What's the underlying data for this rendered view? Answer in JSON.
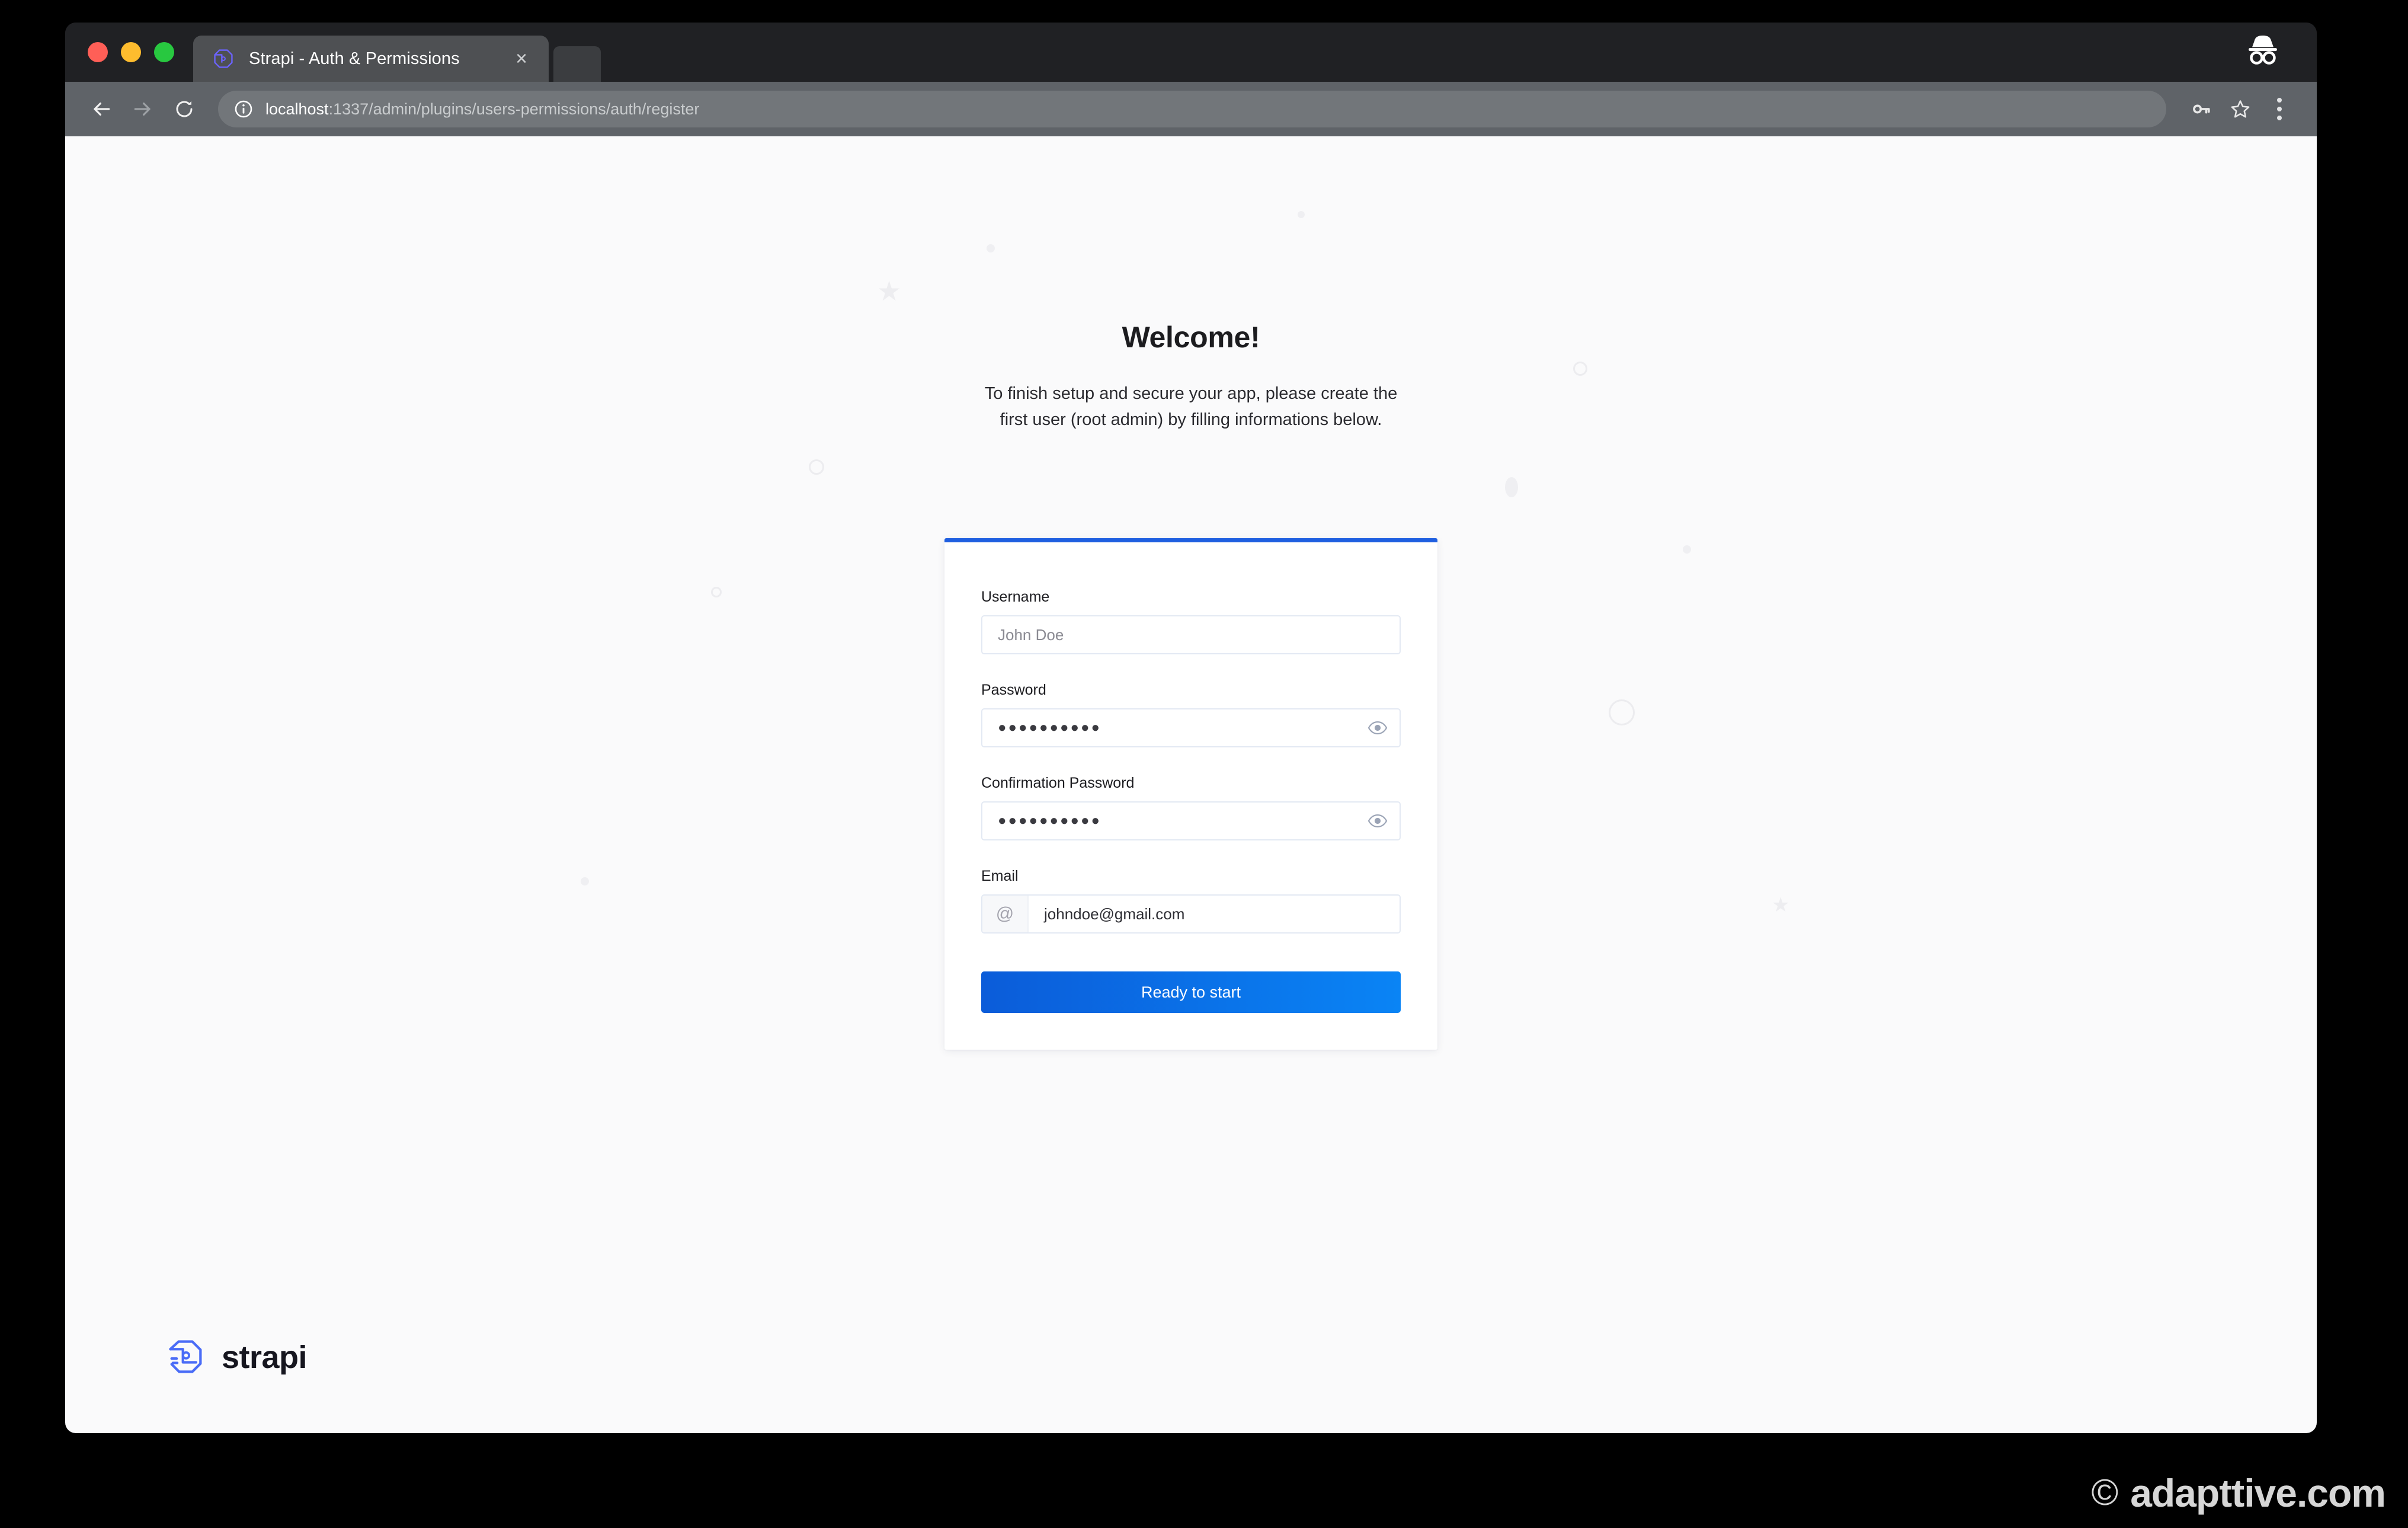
{
  "browser": {
    "tab": {
      "title": "Strapi - Auth & Permissions",
      "favicon_name": "strapi-favicon",
      "close_label": "×"
    },
    "incognito_label": "incognito-icon",
    "nav": {
      "back_label": "Back",
      "forward_label": "Forward",
      "reload_label": "Reload"
    },
    "omnibox": {
      "info_label": "Site information",
      "host": "localhost",
      "path": ":1337/admin/plugins/users-permissions/auth/register",
      "full_url": "localhost:1337/admin/plugins/users-permissions/auth/register"
    },
    "actions": {
      "password_manager_label": "Passwords",
      "bookmark_label": "Bookmark this tab",
      "menu_label": "Customize and control Google Chrome"
    }
  },
  "page": {
    "heading": "Welcome!",
    "subtitle": "To finish setup and secure your app, please create the first user (root admin) by filling informations below.",
    "form": {
      "fields": [
        {
          "label": "Username",
          "value": "",
          "placeholder": "John Doe",
          "is_placeholder": true,
          "type": "text"
        },
        {
          "label": "Password",
          "value": "●●●●●●●●●●",
          "placeholder": "",
          "is_placeholder": false,
          "type": "password"
        },
        {
          "label": "Confirmation Password",
          "value": "●●●●●●●●●●",
          "placeholder": "",
          "is_placeholder": false,
          "type": "password"
        },
        {
          "label": "Email",
          "value": "johndoe@gmail.com",
          "placeholder": "johndoe@gmail.com",
          "is_placeholder": false,
          "type": "email",
          "addon": "@"
        }
      ],
      "submit_label": "Ready to start"
    },
    "logo": {
      "wordmark": "strapi",
      "mark_name": "strapi-logo-mark"
    }
  },
  "watermark": {
    "symbol": "©",
    "text": "adapttive.com"
  },
  "colors": {
    "accent_blue": "#1F5FE0",
    "button_gradient_start": "#0B5CD9",
    "button_gradient_end": "#0A84F5",
    "page_background": "#FAFAFB",
    "card_background": "#FFFFFF",
    "tabstrip": "#202124",
    "toolbar": "#5F6368",
    "strapi_mark_blue": "#4945FF"
  }
}
